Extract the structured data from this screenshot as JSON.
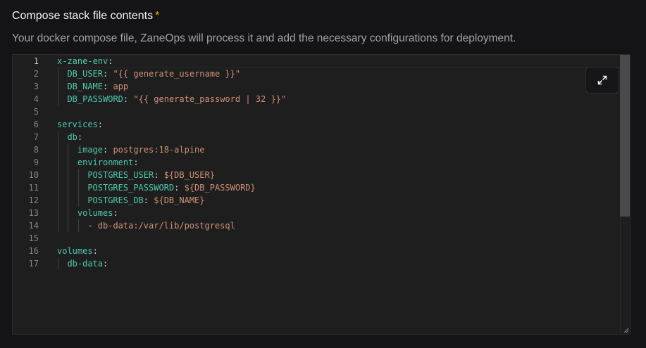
{
  "field": {
    "label": "Compose stack file contents",
    "required_marker": "*",
    "description": "Your docker compose file, ZaneOps will process it and add the necessary configurations for deployment."
  },
  "editor": {
    "active_line": 1,
    "line_numbers": [
      "1",
      "2",
      "3",
      "4",
      "5",
      "6",
      "7",
      "8",
      "9",
      "10",
      "11",
      "12",
      "13",
      "14",
      "15",
      "16",
      "17"
    ],
    "lines": [
      [
        {
          "t": "key",
          "v": "x-zane-env"
        },
        {
          "t": "punct",
          "v": ":"
        }
      ],
      [
        {
          "t": "key",
          "v": "DB_USER"
        },
        {
          "t": "punct",
          "v": ": "
        },
        {
          "t": "str",
          "v": "\"{{ generate_username }}\""
        }
      ],
      [
        {
          "t": "key",
          "v": "DB_NAME"
        },
        {
          "t": "punct",
          "v": ": "
        },
        {
          "t": "str",
          "v": "app"
        }
      ],
      [
        {
          "t": "key",
          "v": "DB_PASSWORD"
        },
        {
          "t": "punct",
          "v": ": "
        },
        {
          "t": "str",
          "v": "\"{{ generate_password | 32 }}\""
        }
      ],
      [],
      [
        {
          "t": "key",
          "v": "services"
        },
        {
          "t": "punct",
          "v": ":"
        }
      ],
      [
        {
          "t": "key",
          "v": "db"
        },
        {
          "t": "punct",
          "v": ":"
        }
      ],
      [
        {
          "t": "key",
          "v": "image"
        },
        {
          "t": "punct",
          "v": ": "
        },
        {
          "t": "str",
          "v": "postgres:18-alpine"
        }
      ],
      [
        {
          "t": "key",
          "v": "environment"
        },
        {
          "t": "punct",
          "v": ":"
        }
      ],
      [
        {
          "t": "key",
          "v": "POSTGRES_USER"
        },
        {
          "t": "punct",
          "v": ": "
        },
        {
          "t": "str",
          "v": "${DB_USER}"
        }
      ],
      [
        {
          "t": "key",
          "v": "POSTGRES_PASSWORD"
        },
        {
          "t": "punct",
          "v": ": "
        },
        {
          "t": "str",
          "v": "${DB_PASSWORD}"
        }
      ],
      [
        {
          "t": "key",
          "v": "POSTGRES_DB"
        },
        {
          "t": "punct",
          "v": ": "
        },
        {
          "t": "str",
          "v": "${DB_NAME}"
        }
      ],
      [
        {
          "t": "key",
          "v": "volumes"
        },
        {
          "t": "punct",
          "v": ":"
        }
      ],
      [
        {
          "t": "punct",
          "v": "- "
        },
        {
          "t": "str",
          "v": "db-data:/var/lib/postgresql"
        }
      ],
      [],
      [
        {
          "t": "key",
          "v": "volumes"
        },
        {
          "t": "punct",
          "v": ":"
        }
      ],
      [
        {
          "t": "key",
          "v": "db-data"
        },
        {
          "t": "punct",
          "v": ":"
        }
      ]
    ]
  },
  "colors": {
    "key": "#4ec9b0",
    "string": "#ce9178",
    "required": "#f5b400"
  },
  "icons": {
    "expand": "expand-diagonal-icon"
  }
}
